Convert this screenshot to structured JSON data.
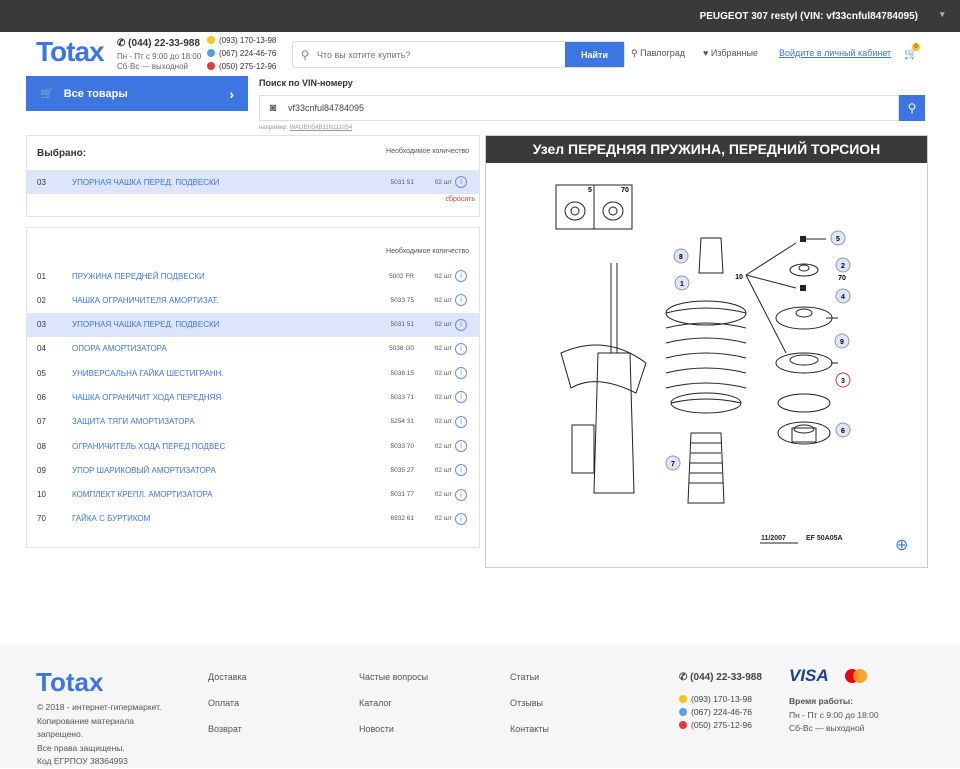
{
  "topbar": {
    "vehicle": "PEUGEOT 307 restyl (VIN: vf33cnful84784095)"
  },
  "header": {
    "logo": "Totax",
    "phone": "(044) 22-33-988",
    "hours_line1": "Пн - Пт с 9:00 до 18:00",
    "hours_line2": "Сб-Вс — выходной",
    "mobile": [
      "(093) 170-13-98",
      "(067) 224-46-76",
      "(050) 275-12-96"
    ],
    "search_placeholder": "Что вы хотите купить?",
    "search_button": "Найти",
    "city": "Павлоград",
    "favorites": "Избранные",
    "login": "Войдите в личный кабинет",
    "cart_count": "0"
  },
  "catalog": {
    "all_goods": "Все товары"
  },
  "vin": {
    "title": "Поиск по VIN-номеру",
    "value": "vf33cnful84784095",
    "example_label": "например:",
    "example_value": "WAUBH54B11N111054"
  },
  "selected": {
    "title": "Выбрано:",
    "col_qty": "Необходимое количество",
    "rows": [
      {
        "num": "03",
        "name": "УПОРНАЯ ЧАШКА ПЕРЕД. ПОДВЕСКИ",
        "code": "5031 51",
        "qty": "02 шт"
      }
    ],
    "reset": "сбросить"
  },
  "parts": {
    "col_qty": "Необходимое количество",
    "rows": [
      {
        "num": "01",
        "name": "ПРУЖИНА ПЕРЕДНЕЙ ПОДВЕСКИ",
        "code": "5002 FR",
        "qty": "02 шт"
      },
      {
        "num": "02",
        "name": "ЧАШКА ОГРАНИЧИТЕЛЯ АМОРТИЗАТ.",
        "code": "5033 75",
        "qty": "02 шт"
      },
      {
        "num": "03",
        "name": "УПОРНАЯ ЧАШКА ПЕРЕД. ПОДВЕСКИ",
        "code": "5031 51",
        "qty": "02 шт"
      },
      {
        "num": "04",
        "name": "ОПОРА АМОРТИЗАТОРА",
        "code": "5038 G0",
        "qty": "02 шт"
      },
      {
        "num": "05",
        "name": "УНИВЕРСАЛЬНА ГАЙКА ШЕСТИГРАНН.",
        "code": "5036 15",
        "qty": "02 шт"
      },
      {
        "num": "06",
        "name": "ЧАШКА ОГРАНИЧИТ ХОДА ПЕРЕДНЯЯ",
        "code": "5033 71",
        "qty": "02 шт"
      },
      {
        "num": "07",
        "name": "ЗАЩИТА ТЯГИ АМОРТИЗАТОРА",
        "code": "5254 31",
        "qty": "02 шт"
      },
      {
        "num": "08",
        "name": "ОГРАНИЧИТЕЛЬ ХОДА ПЕРЕД ПОДВЕС",
        "code": "5033 70",
        "qty": "02 шт"
      },
      {
        "num": "09",
        "name": "УПОР ШАРИКОВЫЙ АМОРТИЗАТОРА",
        "code": "5035 27",
        "qty": "02 шт"
      },
      {
        "num": "10",
        "name": "КОМПЛЕКТ КРЕПЛ. АМОРТИЗАТОРА",
        "code": "5031 77",
        "qty": "02 шт"
      },
      {
        "num": "70",
        "name": "ГАЙКА С БУРТИКОМ",
        "code": "6932 61",
        "qty": "02 шт"
      }
    ]
  },
  "diagram": {
    "title": "Узел ПЕРЕДНЯЯ ПРУЖИНА, ПЕРЕДНИЙ ТОРСИОН",
    "date": "11/2007",
    "ref": "EF 50A05A",
    "inset_labels": [
      "5",
      "70"
    ],
    "callouts": [
      "1",
      "2",
      "3",
      "4",
      "5",
      "6",
      "7",
      "8",
      "9",
      "10",
      "70"
    ]
  },
  "footer": {
    "logo": "Totax",
    "copyright": [
      "© 2018 - интернет-гипермаркет.",
      "Копирование материала",
      "запрещено.",
      "Все права защищены.",
      "Код ЕГРПОУ 38364993"
    ],
    "col1": [
      "Доставка",
      "Оплата",
      "Возврат"
    ],
    "col2": [
      "Частые вопросы",
      "Каталог",
      "Новости"
    ],
    "col3": [
      "Статьи",
      "Отзывы",
      "Контакты"
    ],
    "phone": "(044) 22-33-988",
    "mobile": [
      "(093) 170-13-98",
      "(067) 224-46-76",
      "(050) 275-12-96"
    ],
    "visa": "VISA",
    "hours_title": "Время работы:",
    "hours_line1": "Пн - Пт с 9:00 до 18:00",
    "hours_line2": "Сб-Вс — выходной"
  },
  "colors": {
    "accent": "#3d76e0",
    "topbar": "#3a3a3a",
    "highlight": "#dde5fa",
    "reset": "#e03a3a"
  },
  "icons": [
    "phone-icon",
    "lifecell-icon",
    "kyivstar-icon",
    "vodafone-icon",
    "search-icon",
    "location-icon",
    "heart-icon",
    "cart-icon",
    "camera-icon",
    "info-icon",
    "zoom-icon",
    "chevron-right-icon",
    "chevron-down-icon"
  ]
}
